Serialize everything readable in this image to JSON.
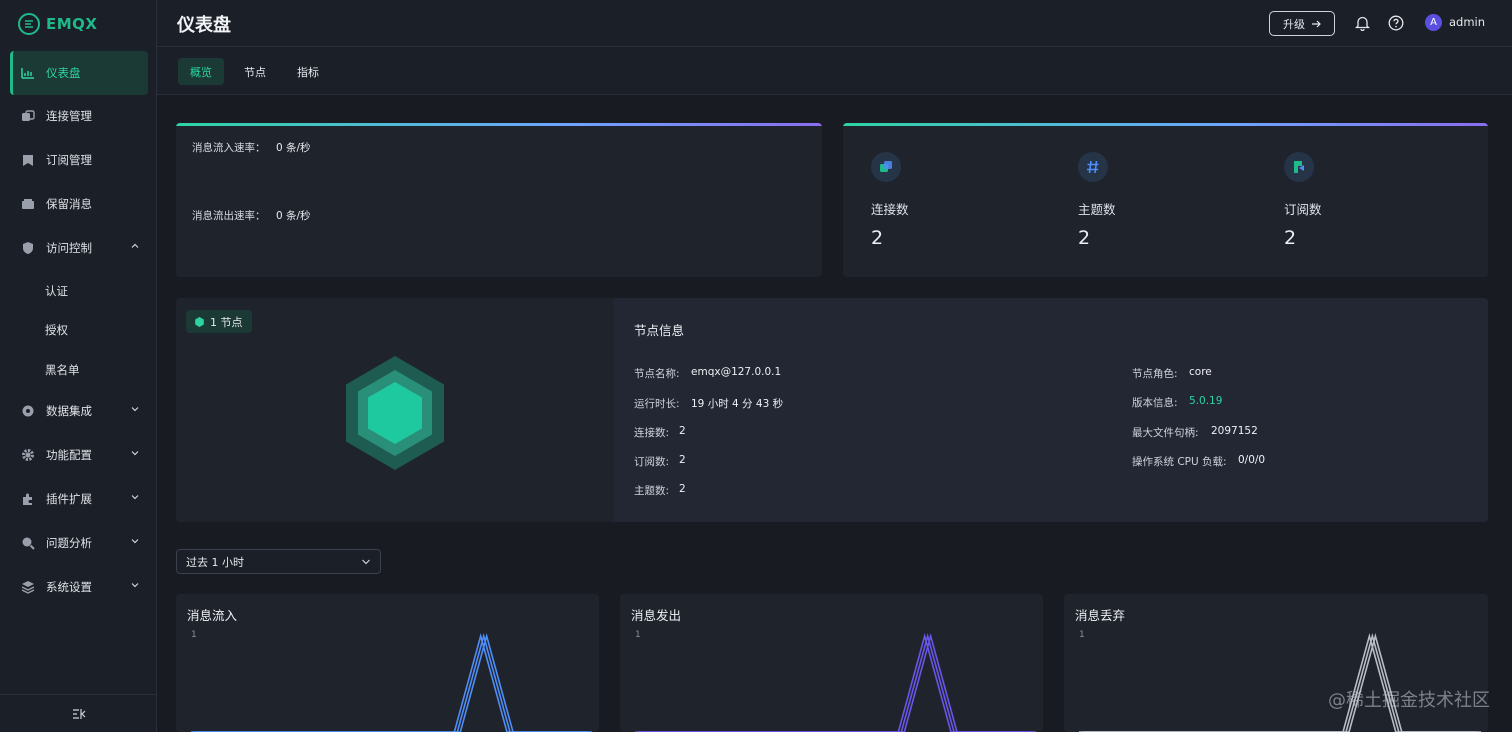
{
  "app": {
    "logo_text": "EMQX"
  },
  "sidebar": {
    "items": [
      {
        "label": "仪表盘",
        "icon": "dashboard-icon",
        "active": true
      },
      {
        "label": "连接管理",
        "icon": "connections-icon"
      },
      {
        "label": "订阅管理",
        "icon": "subscriptions-icon"
      },
      {
        "label": "保留消息",
        "icon": "retained-icon"
      },
      {
        "label": "访问控制",
        "icon": "shield-icon",
        "expanded": true
      },
      {
        "label": "数据集成",
        "icon": "integration-icon"
      },
      {
        "label": "功能配置",
        "icon": "gear-icon"
      },
      {
        "label": "插件扩展",
        "icon": "plugin-icon"
      },
      {
        "label": "问题分析",
        "icon": "diagnose-icon"
      },
      {
        "label": "系统设置",
        "icon": "system-icon"
      }
    ],
    "sub_items": [
      "认证",
      "授权",
      "黑名单"
    ]
  },
  "header": {
    "title": "仪表盘",
    "upgrade_label": "升级",
    "avatar_initial": "A",
    "username": "admin"
  },
  "tabs": [
    {
      "label": "概览"
    },
    {
      "label": "节点"
    },
    {
      "label": "指标"
    }
  ],
  "rates": {
    "in_label": "消息流入速率：",
    "in_value": "0 条/秒",
    "out_label": "消息流出速率：",
    "out_value": "0 条/秒"
  },
  "stats": [
    {
      "label": "连接数",
      "value": "2",
      "icon": "connection-icon",
      "color": "#1fb98a"
    },
    {
      "label": "主题数",
      "value": "2",
      "icon": "hash-icon",
      "color": "#4f8df7"
    },
    {
      "label": "订阅数",
      "value": "2",
      "icon": "subscribe-icon",
      "color": "#1fb98a"
    }
  ],
  "node": {
    "badge": "1 节点",
    "info_title": "节点信息",
    "name_label": "节点名称:",
    "name_value": "emqx@127.0.0.1",
    "uptime_label": "运行时长:",
    "uptime_value": "19 小时 4 分 43 秒",
    "conn_label": "连接数:",
    "conn_value": "2",
    "sub_label": "订阅数:",
    "sub_value": "2",
    "topic_label": "主题数:",
    "topic_value": "2",
    "role_label": "节点角色:",
    "role_value": "core",
    "version_label": "版本信息:",
    "version_value": "5.0.19",
    "fd_label": "最大文件句柄:",
    "fd_value": "2097152",
    "cpu_label": "操作系统 CPU 负载:",
    "cpu_value": "0/0/0"
  },
  "time_range": {
    "selected": "过去 1 小时"
  },
  "colors": {
    "accent": "#1fb98a",
    "in": "#4f8df7",
    "out": "#6a55e8",
    "dropped": "#b7bcc6"
  },
  "chart_data": [
    {
      "type": "line",
      "title": "消息流入",
      "ylim": [
        0,
        1
      ],
      "yticks": [
        "1"
      ],
      "series": [
        {
          "values": [
            0,
            0,
            0,
            0,
            0,
            0,
            0,
            0,
            0,
            0,
            0,
            1,
            0,
            0,
            0,
            0
          ]
        }
      ]
    },
    {
      "type": "line",
      "title": "消息发出",
      "ylim": [
        0,
        1
      ],
      "yticks": [
        "1"
      ],
      "series": [
        {
          "values": [
            0,
            0,
            0,
            0,
            0,
            0,
            0,
            0,
            0,
            0,
            0,
            1,
            0,
            0,
            0,
            0
          ]
        }
      ]
    },
    {
      "type": "line",
      "title": "消息丢弃",
      "ylim": [
        0,
        1
      ],
      "yticks": [
        "1"
      ],
      "series": [
        {
          "values": [
            0,
            0,
            0,
            0,
            0,
            0,
            0,
            0,
            0,
            0,
            0,
            1,
            0,
            0,
            0,
            0
          ]
        }
      ]
    }
  ],
  "watermark": "@稀土掘金技术社区"
}
